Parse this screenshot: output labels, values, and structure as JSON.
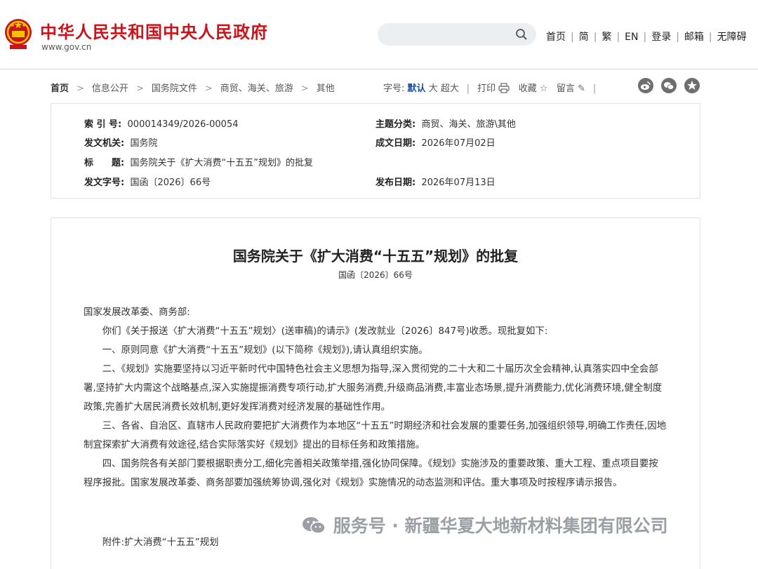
{
  "site": {
    "title": "中华人民共和国中央人民政府",
    "domain": "www.gov.cn"
  },
  "search": {
    "placeholder": ""
  },
  "topnav": [
    "首页",
    "简",
    "繁",
    "EN",
    "登录",
    "邮箱",
    "无障碍"
  ],
  "breadcrumb": [
    "首页",
    "信息公开",
    "国务院文件",
    "商贸、海关、旅游",
    "其他"
  ],
  "tools": {
    "fontsize_label": "字号:",
    "size_default": "默认",
    "size_large": "大",
    "size_xlarge": "超大",
    "print": "打印",
    "favorite": "收藏",
    "comment": "留言"
  },
  "meta": {
    "index_key": "索 引 号:",
    "index_val": "000014349/2026-00054",
    "topic_key": "主题分类:",
    "topic_val": "商贸、海关、旅游\\其他",
    "issuer_key": "发文机关:",
    "issuer_val": "国务院",
    "created_key": "成文日期:",
    "created_val": "2026年07月02日",
    "title_key": "标　　题:",
    "title_val": "国务院关于《扩大消费“十五五”规划》的批复",
    "docno_key": "发文字号:",
    "docno_val": "国函〔2026〕66号",
    "published_key": "发布日期:",
    "published_val": "2026年07月13日"
  },
  "article": {
    "title": "国务院关于《扩大消费“十五五”规划》的批复",
    "docno": "国函〔2026〕66号",
    "salutation": "国家发展改革委、商务部:",
    "paragraphs": [
      "你们《关于报送〈扩大消费“十五五”规划〉(送审稿)的请示》(发改就业〔2026〕847号)收悉。现批复如下:",
      "一、原则同意《扩大消费“十五五”规划》(以下简称《规划》),请认真组织实施。",
      "二、《规划》实施要坚持以习近平新时代中国特色社会主义思想为指导,深入贯彻党的二十大和二十届历次全会精神,认真落实四中全会部署,坚持扩大内需这个战略基点,深入实施提振消费专项行动,扩大服务消费,升级商品消费,丰富业态场景,提升消费能力,优化消费环境,健全制度政策,完善扩大居民消费长效机制,更好发挥消费对经济发展的基础性作用。",
      "三、各省、自治区、直辖市人民政府要把扩大消费作为本地区“十五五”时期经济和社会发展的重要任务,加强组织领导,明确工作责任,因地制宜探索扩大消费有效途径,结合实际落实好《规划》提出的目标任务和政策措施。",
      "四、国务院各有关部门要根据职责分工,细化完善相关政策举措,强化协同保障。《规划》实施涉及的重要政策、重大工程、重点项目要按程序报批。国家发展改革委、商务部要加强统筹协调,强化对《规划》实施情况的动态监测和评估。重大事项及时按程序请示报告。"
    ],
    "attachment": "附件:扩大消费“十五五”规划"
  },
  "watermark": "服务号 · 新疆华夏大地新材料集团有限公司",
  "colors": {
    "brand_red": "#c8141a",
    "link_blue": "#1a52a8"
  }
}
